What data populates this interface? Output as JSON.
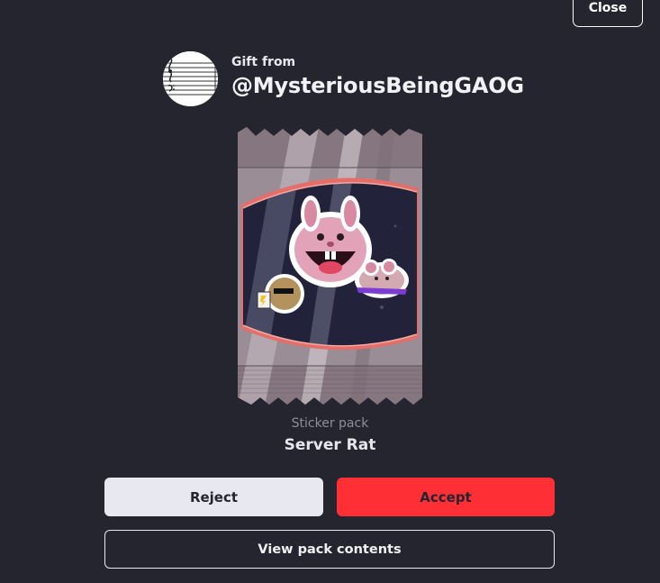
{
  "header": {
    "close_label": "Close"
  },
  "gift": {
    "from_label": "Gift from",
    "sender": "@MysteriousBeingGAOG"
  },
  "pack": {
    "type_label": "Sticker pack",
    "name": "Server Rat"
  },
  "actions": {
    "reject_label": "Reject",
    "accept_label": "Accept",
    "view_contents_label": "View pack contents"
  },
  "colors": {
    "background": "#25252f",
    "accept": "#ff2f36",
    "reject": "#e8e8f0"
  }
}
